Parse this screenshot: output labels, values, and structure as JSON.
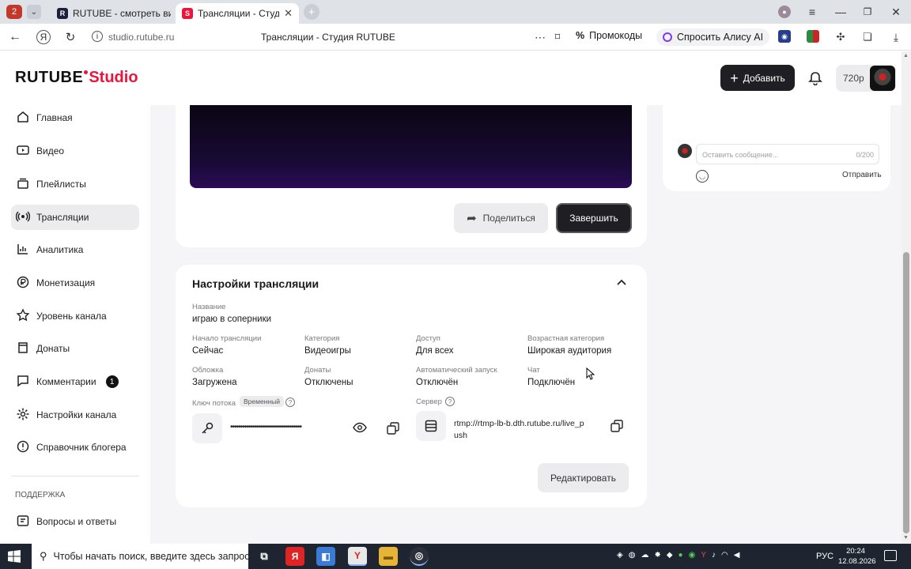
{
  "browser": {
    "profile_badge": "2",
    "tabs": [
      {
        "label": "RUTUBE - смотреть виде",
        "favicon": "R"
      },
      {
        "label": "Трансляции - Студия R",
        "favicon": "S"
      }
    ],
    "url": "studio.rutube.ru",
    "page_title": "Трансляции - Студия RUTUBE",
    "promo_label": "Промокоды",
    "alice_label": "Спросить Алису AI"
  },
  "header": {
    "logo_main": "RUTUBE",
    "logo_studio": "Studio",
    "add_button": "Добавить",
    "quality": "720p"
  },
  "sidebar": {
    "items": [
      {
        "label": "Главная",
        "icon": "home-icon"
      },
      {
        "label": "Видео",
        "icon": "video-icon"
      },
      {
        "label": "Плейлисты",
        "icon": "playlist-icon"
      },
      {
        "label": "Трансляции",
        "icon": "broadcast-icon",
        "active": true
      },
      {
        "label": "Аналитика",
        "icon": "analytics-icon"
      },
      {
        "label": "Монетизация",
        "icon": "money-icon"
      },
      {
        "label": "Уровень канала",
        "icon": "star-icon"
      },
      {
        "label": "Донаты",
        "icon": "donate-icon"
      },
      {
        "label": "Комментарии",
        "icon": "comment-icon",
        "badge": "1"
      },
      {
        "label": "Настройки канала",
        "icon": "gear-icon"
      },
      {
        "label": "Справочник блогера",
        "icon": "book-icon"
      }
    ],
    "support_heading": "ПОДДЕРЖКА",
    "support_items": [
      {
        "label": "Вопросы и ответы",
        "icon": "help-icon"
      }
    ]
  },
  "stream_actions": {
    "share": "Поделиться",
    "finish": "Завершить"
  },
  "chat": {
    "placeholder": "Оставить сообщение...",
    "counter": "0/200",
    "send": "Отправить"
  },
  "settings": {
    "title": "Настройки трансляции",
    "name_label": "Название",
    "name_value": "играю в соперники",
    "fields": [
      {
        "label": "Начало трансляции",
        "value": "Сейчас"
      },
      {
        "label": "Категория",
        "value": "Видеоигры"
      },
      {
        "label": "Доступ",
        "value": "Для всех"
      },
      {
        "label": "Возрастная категория",
        "value": "Широкая аудитория"
      },
      {
        "label": "Обложка",
        "value": "Загружена"
      },
      {
        "label": "Донаты",
        "value": "Отключены"
      },
      {
        "label": "Автоматический запуск",
        "value": "Отключён"
      },
      {
        "label": "Чат",
        "value": "Подключён"
      }
    ],
    "key_label": "Ключ потока",
    "key_tag": "Временный",
    "key_masked": "••••••••••••••••••••••••••••••••••••",
    "server_label": "Сервер",
    "server_value_line1": "rtmp://rtmp-lb-b.dth.rutube.ru/live_p",
    "server_value_line2": "ush",
    "edit_button": "Редактировать"
  },
  "taskbar": {
    "search_placeholder": "Чтобы начать поиск, введите здесь запрос",
    "lang": "РУС",
    "time": "20:24",
    "date": "12.08.2026"
  },
  "colors": {
    "accent_red": "#ed143b",
    "dark_button": "#1f1f23",
    "player_bg": "#1a0b3a"
  }
}
